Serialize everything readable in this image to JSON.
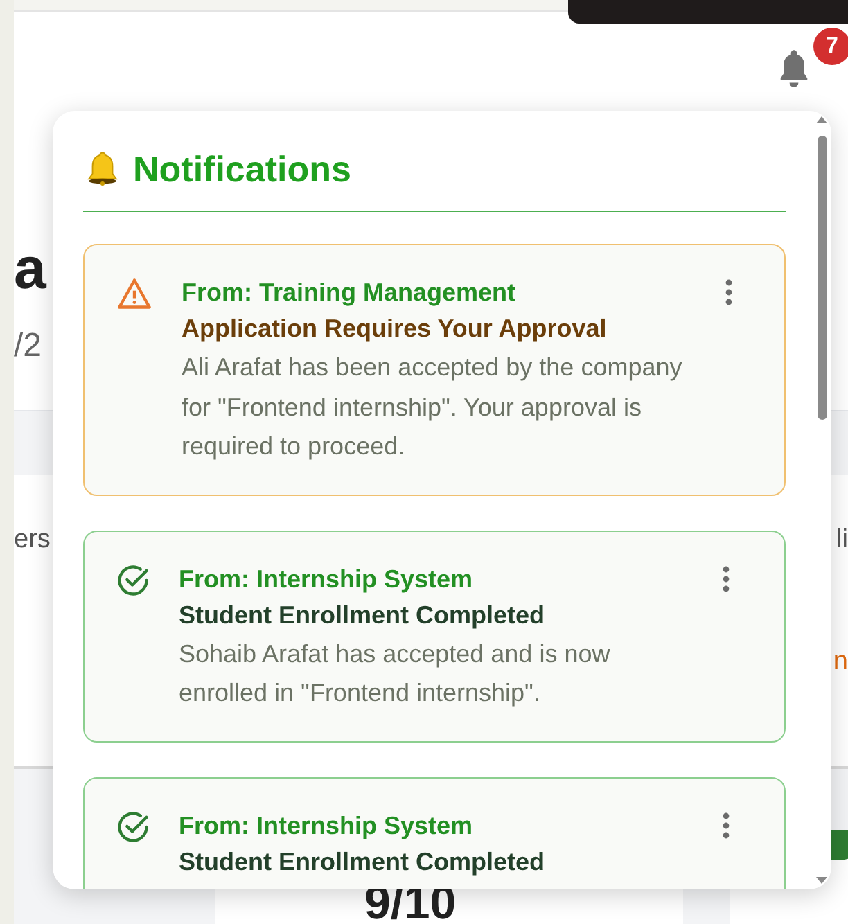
{
  "background_page": {
    "heading_fragment": "a",
    "date_fragment": "/2",
    "stat_label_fragment": "ers",
    "right_label_fragment": "li",
    "right_value_fragment": "n",
    "score": "9/10"
  },
  "header": {
    "notification_count": "7"
  },
  "notifications_panel": {
    "title": "Notifications",
    "items": [
      {
        "kind": "warning",
        "from": "From: Training Management",
        "title": "Application Requires Your Approval",
        "body": "Ali Arafat has been accepted by the company for \"Frontend internship\". Your approval is required to proceed."
      },
      {
        "kind": "success",
        "from": "From: Internship System",
        "title": "Student Enrollment Completed",
        "body": "Sohaib Arafat has accepted and is now enrolled in \"Frontend internship\"."
      },
      {
        "kind": "success",
        "from": "From: Internship System",
        "title": "Student Enrollment Completed"
      }
    ]
  }
}
